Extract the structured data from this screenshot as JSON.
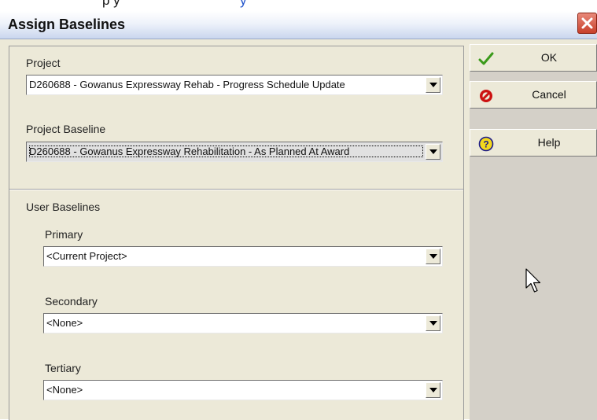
{
  "top_strip": {
    "text_left": "p y",
    "text_right": "y"
  },
  "dialog": {
    "title": "Assign Baselines",
    "project": {
      "label": "Project",
      "value": "D260688 - Gowanus Expressway Rehab - Progress Schedule Update"
    },
    "project_baseline": {
      "label": "Project Baseline",
      "value": "D260688 - Gowanus Expressway Rehabilitation - As Planned At Award"
    },
    "user_baselines": {
      "label": "User Baselines",
      "primary": {
        "label": "Primary",
        "value": "<Current Project>"
      },
      "secondary": {
        "label": "Secondary",
        "value": "<None>"
      },
      "tertiary": {
        "label": "Tertiary",
        "value": "<None>"
      }
    },
    "buttons": {
      "ok": "OK",
      "cancel": "Cancel",
      "help": "Help"
    }
  },
  "colors": {
    "title_gradient_bottom": "#c9d6ee",
    "dialog_bg": "#ece9d8",
    "close_red": "#c8402b",
    "ok_check_green": "#3a9a1a",
    "cancel_red": "#cc1111",
    "help_yellow": "#f4d81c"
  },
  "icons": {
    "close": "close-x-icon",
    "ok": "checkmark-icon",
    "cancel": "stop-icon",
    "help": "question-icon",
    "cursor": "mouse-pointer-icon"
  }
}
